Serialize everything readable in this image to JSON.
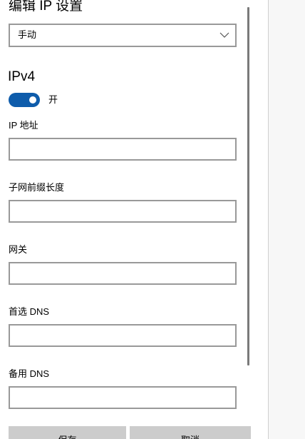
{
  "dialog": {
    "title": "编辑 IP 设置",
    "mode_select": {
      "value": "手动",
      "icon": "chevron-down-icon"
    },
    "section_title": "IPv4",
    "toggle": {
      "on": true,
      "label": "开",
      "accent_color": "#0e5cab"
    },
    "fields": [
      {
        "label": "IP 地址",
        "value": ""
      },
      {
        "label": "子网前缀长度",
        "value": ""
      },
      {
        "label": "网关",
        "value": ""
      },
      {
        "label": "首选 DNS",
        "value": ""
      },
      {
        "label": "备用 DNS",
        "value": ""
      }
    ],
    "buttons": {
      "save": "保存",
      "cancel": "取消"
    }
  }
}
